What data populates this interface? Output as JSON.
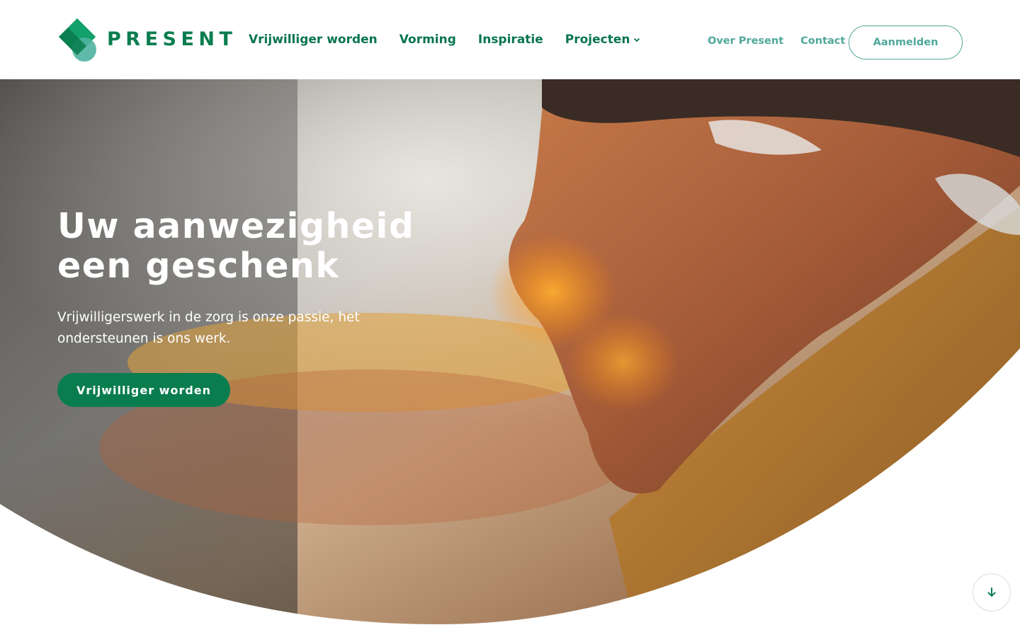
{
  "brand": {
    "name": "PRESENT",
    "primary_color": "#0a7d4f",
    "secondary_color": "#4fa89a"
  },
  "nav": {
    "main": [
      {
        "label": "Vrijwilliger worden"
      },
      {
        "label": "Vorming"
      },
      {
        "label": "Inspiratie"
      },
      {
        "label": "Projecten",
        "icon": "chevron-down-icon"
      }
    ],
    "secondary": [
      {
        "label": "Over Present"
      },
      {
        "label": "Contact"
      }
    ],
    "login_label": "Aanmelden"
  },
  "hero": {
    "title_line1": "Uw aanwezigheid",
    "title_line2": "een geschenk",
    "subtitle": "Vrijwilligerswerk in de zorg is onze passie, het ondersteunen is ons werk.",
    "cta_label": "Vrijwilliger worden",
    "image": "elderly-man-portrait-photo"
  },
  "scroll_button": {
    "icon": "arrow-down-icon"
  }
}
